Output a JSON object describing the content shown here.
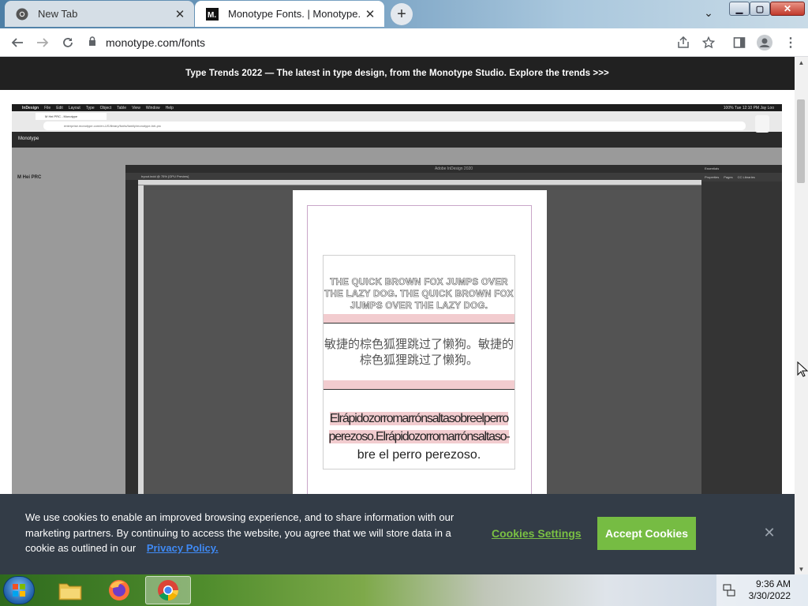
{
  "browser": {
    "tabs": [
      {
        "label": "New Tab",
        "icon": "chrome-icon"
      },
      {
        "label": "Monotype Fonts. | Monotype.",
        "icon": "monotype-m-icon"
      }
    ],
    "url": "monotype.com/fonts"
  },
  "banner": {
    "text": "Type Trends 2022 — The latest in type design, from the Monotype Studio. Explore the trends >>>"
  },
  "video": {
    "mac_menu": [
      "InDesign",
      "File",
      "Edit",
      "Layout",
      "Type",
      "Object",
      "Table",
      "View",
      "Window",
      "Help"
    ],
    "mac_status": "100%  Tue 12:10 PM  Jay Loo",
    "inner_tab": "M Hei PRC - Monotype",
    "inner_url": "enterprise.monotype.com/en-US/library/fonts/family/monotype-hei-prc",
    "site_logo": "Monotype",
    "font_family": "M Hei PRC",
    "indesign_title": "Adobe InDesign 2020",
    "doc_tab": "tryout.indd @ 75% [GPU Preview]",
    "panel_header": "Essentials",
    "panel_tabs": [
      "Properties",
      "Pages",
      "CC Libraries"
    ],
    "sample_text_1": "THE QUICK BROWN FOX JUMPS OVER THE LAZY DOG. THE QUICK BROWN FOX JUMPS OVER THE LAZY DOG.",
    "sample_text_2": "敏捷的棕色狐狸跳过了懒狗。敏捷的棕色狐狸跳过了懒狗。",
    "sample_text_3a": "Elrápidozorromarrónsaltasobreelperro perezoso.Elrápidozorromarrónsaltaso-",
    "sample_text_3b": "bre el perro perezoso."
  },
  "cookie": {
    "message": "We use cookies to enable an improved browsing experience, and to share information with our marketing partners. By continuing to access the website, you agree that we will store data in a cookie as outlined in our",
    "privacy_link": "Privacy Policy.",
    "settings_label": "Cookies Settings",
    "accept_label": "Accept Cookies"
  },
  "taskbar": {
    "time": "9:36 AM",
    "date": "3/30/2022",
    "apps": [
      "file-explorer-icon",
      "firefox-icon",
      "chrome-icon"
    ]
  },
  "colors": {
    "cookie_bg": "#333c47",
    "accept_green": "#76bc43",
    "privacy_blue": "#3f8af5",
    "banner_bg": "#212121"
  }
}
